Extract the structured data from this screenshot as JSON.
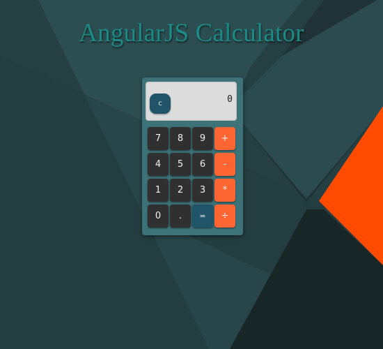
{
  "page": {
    "title": "AngularJS Calculator"
  },
  "calculator": {
    "display_value": "0",
    "clear_label": "c",
    "keys": [
      {
        "label": "7",
        "name": "key-7",
        "kind": "digit"
      },
      {
        "label": "8",
        "name": "key-8",
        "kind": "digit"
      },
      {
        "label": "9",
        "name": "key-9",
        "kind": "digit"
      },
      {
        "label": "+",
        "name": "key-plus",
        "kind": "op"
      },
      {
        "label": "4",
        "name": "key-4",
        "kind": "digit"
      },
      {
        "label": "5",
        "name": "key-5",
        "kind": "digit"
      },
      {
        "label": "6",
        "name": "key-6",
        "kind": "digit"
      },
      {
        "label": "-",
        "name": "key-minus",
        "kind": "op"
      },
      {
        "label": "1",
        "name": "key-1",
        "kind": "digit"
      },
      {
        "label": "2",
        "name": "key-2",
        "kind": "digit"
      },
      {
        "label": "3",
        "name": "key-3",
        "kind": "digit"
      },
      {
        "label": "*",
        "name": "key-multiply",
        "kind": "op"
      },
      {
        "label": "0",
        "name": "key-0",
        "kind": "digit"
      },
      {
        "label": ".",
        "name": "key-decimal",
        "kind": "digit"
      },
      {
        "label": "=",
        "name": "key-equals",
        "kind": "eq"
      },
      {
        "label": "÷",
        "name": "key-divide",
        "kind": "op"
      }
    ]
  },
  "colors": {
    "background": "#243f42",
    "accent_orange": "#fd6633",
    "equals_blue": "#215369",
    "title_teal": "#1c8a86"
  }
}
